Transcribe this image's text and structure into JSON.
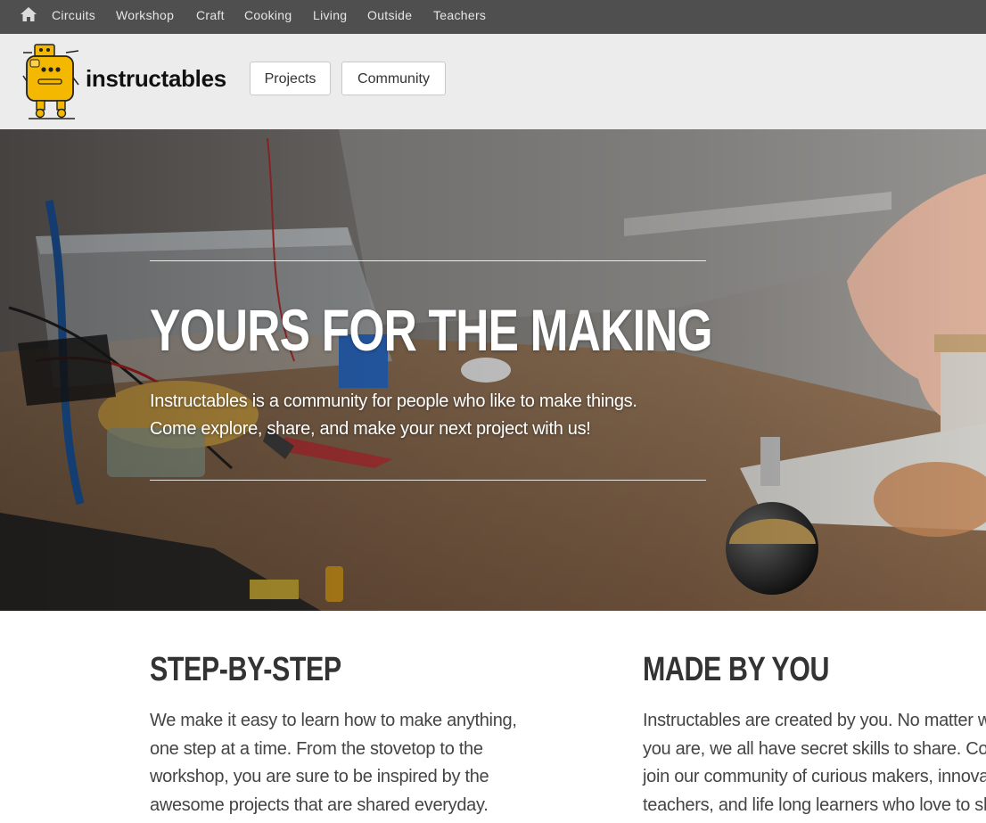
{
  "topbar": {
    "home_icon": "home-icon",
    "categories": [
      "Circuits",
      "Workshop",
      "Craft",
      "Cooking",
      "Living",
      "Outside",
      "Teachers"
    ]
  },
  "header": {
    "logo_text": "instructables",
    "logo_icon": "robot-mascot-icon",
    "nav": [
      "Projects",
      "Community"
    ]
  },
  "hero": {
    "title": "YOURS FOR THE MAKING",
    "text_lines": [
      "Instructables is a community for people who like to make things.",
      "Come explore, share, and make your next project with us!"
    ]
  },
  "features": [
    {
      "title": "STEP-BY-STEP",
      "lines": [
        "We make it easy to learn how to make anything,",
        "one step at a time. From the stovetop to the",
        "workshop, you are sure to be inspired by the",
        "awesome projects that are shared everyday."
      ]
    },
    {
      "title": "MADE BY YOU",
      "lines": [
        "Instructables are created by you. No matter who",
        "you are, we all have secret skills to share. Come",
        "join our community of curious makers, innovators,",
        "teachers, and life long learners who love to share"
      ]
    }
  ],
  "colors": {
    "topbar_bg": "#4f4f4f",
    "header_bg": "#ececec",
    "robot_yellow": "#f5b800"
  }
}
